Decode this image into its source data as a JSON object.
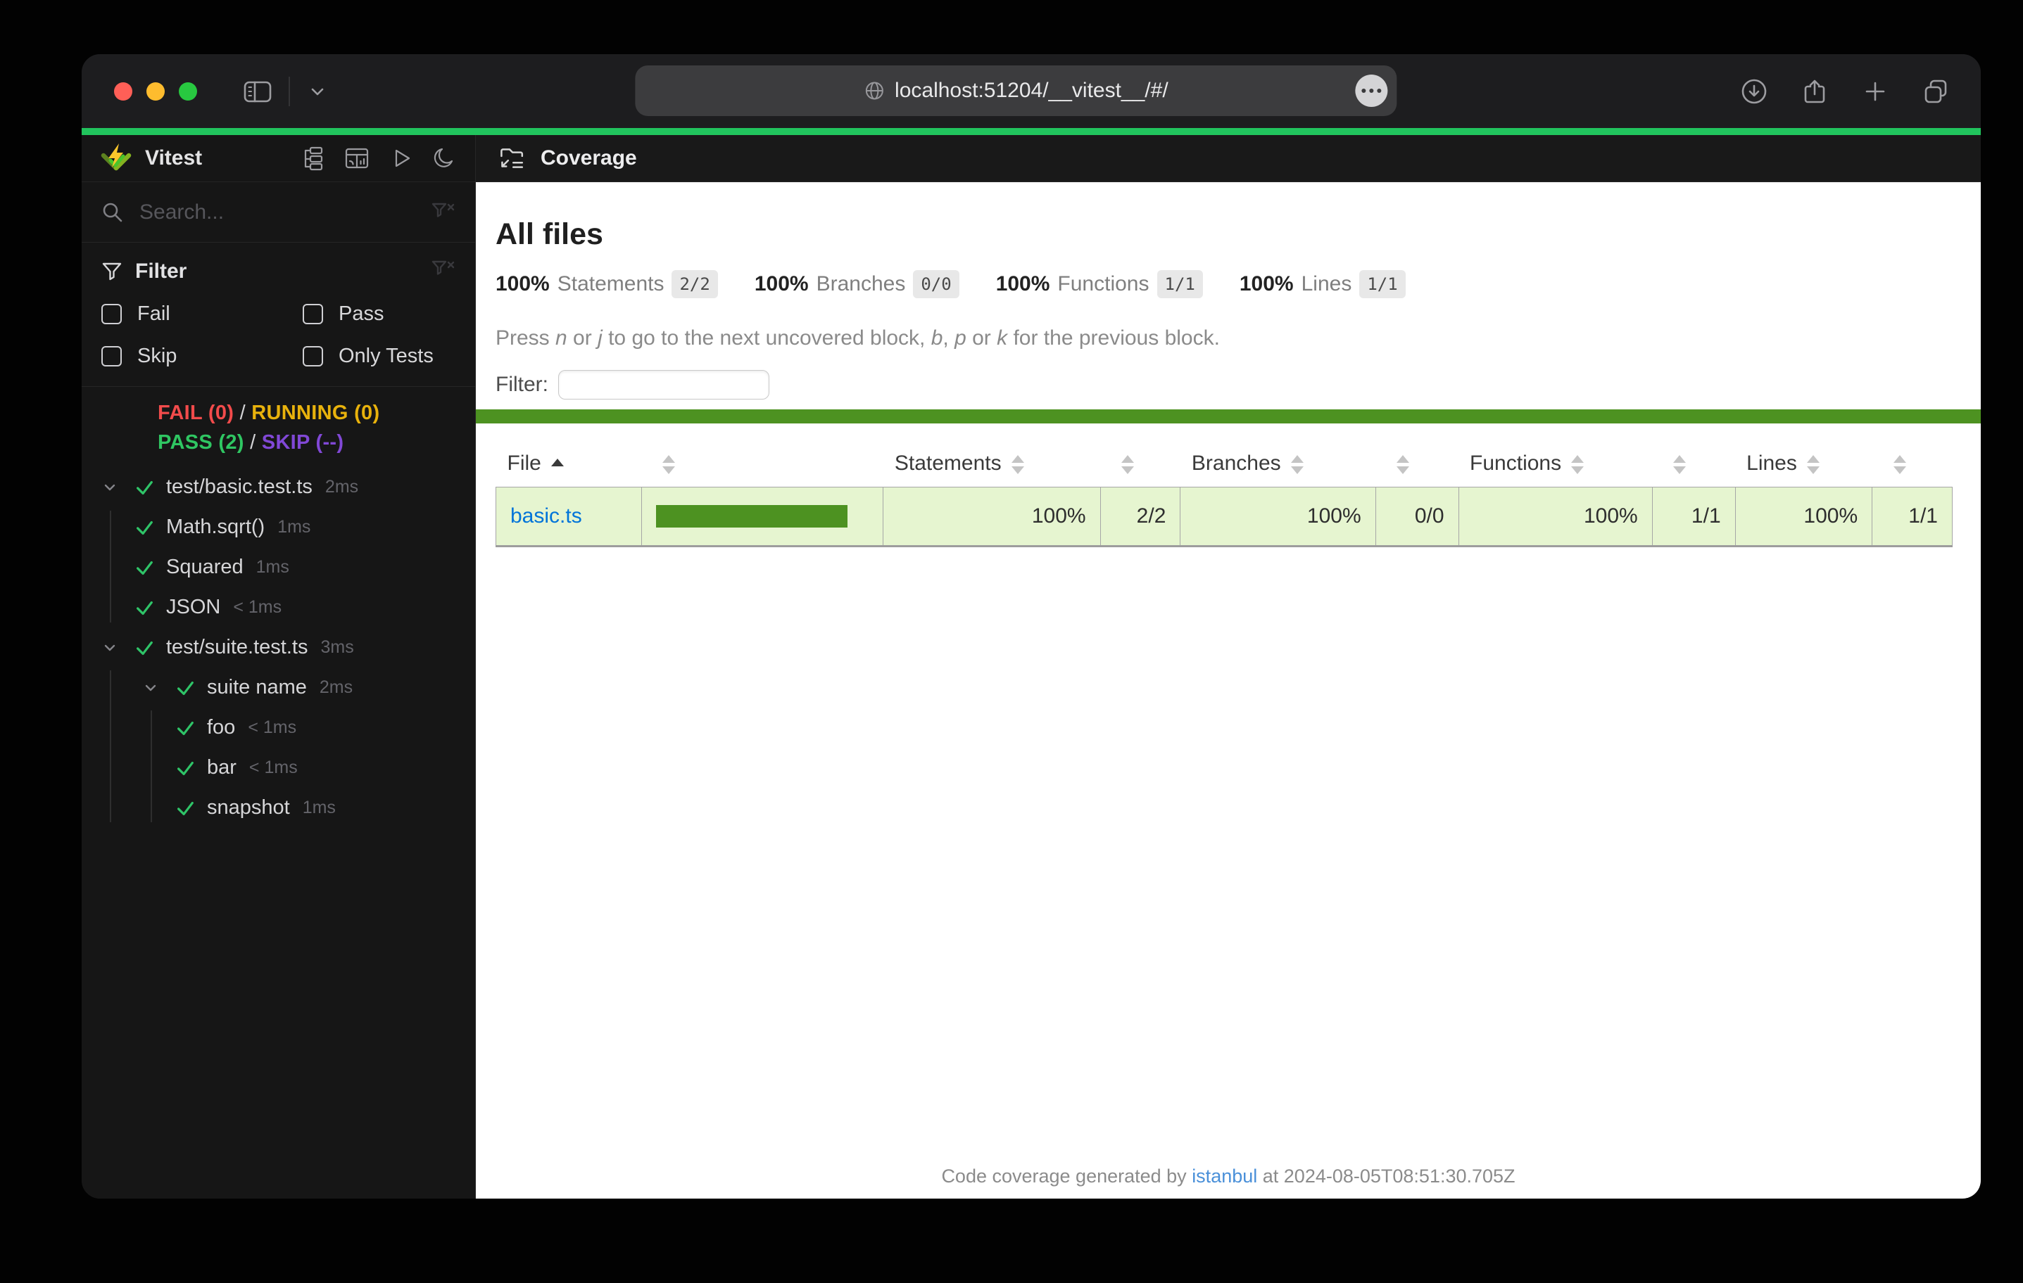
{
  "browser": {
    "url": "localhost:51204/__vitest__/#/"
  },
  "icons": {
    "traffic-lights": "red/yellow/green circles",
    "sidebar-toggle": "split rectangle",
    "chevron-down": "v",
    "globe": "circle with meridians",
    "page-menu": "three dots in circle",
    "download": "circle with down arrow",
    "share": "square with up arrow",
    "new-tab": "plus",
    "tab-overview": "two overlapping squares",
    "vitest-logo": "green V with yellow lightning bolt",
    "tree-view": "three linked blocks",
    "dashboard": "window with chart",
    "run-all": "play triangle outline",
    "dark-mode": "crescent moon",
    "search": "magnifier",
    "filter": "funnel",
    "clear-filter": "funnel with x",
    "pass-check": "green checkmark",
    "coverage": "folder with arrow and lines",
    "sorter": "up and down triangles"
  },
  "sidebar": {
    "app_title": "Vitest",
    "search_placeholder": "Search...",
    "filter": {
      "title": "Filter",
      "options": [
        "Fail",
        "Pass",
        "Skip",
        "Only Tests"
      ]
    },
    "status": {
      "fail": "FAIL (0)",
      "sep": " / ",
      "running": "RUNNING (0)",
      "pass": "PASS (2)",
      "skip": "SKIP (--)"
    },
    "tree": [
      {
        "label": "test/basic.test.ts",
        "duration": "2ms"
      },
      {
        "label": "Math.sqrt()",
        "duration": "1ms"
      },
      {
        "label": "Squared",
        "duration": "1ms"
      },
      {
        "label": "JSON",
        "duration": "< 1ms"
      },
      {
        "label": "test/suite.test.ts",
        "duration": "3ms"
      },
      {
        "label": "suite name",
        "duration": "2ms"
      },
      {
        "label": "foo",
        "duration": "< 1ms"
      },
      {
        "label": "bar",
        "duration": "< 1ms"
      },
      {
        "label": "snapshot",
        "duration": "1ms"
      }
    ]
  },
  "main": {
    "header_title": "Coverage",
    "report": {
      "title": "All files",
      "stats": [
        {
          "pct": "100%",
          "label": "Statements",
          "frac": "2/2"
        },
        {
          "pct": "100%",
          "label": "Branches",
          "frac": "0/0"
        },
        {
          "pct": "100%",
          "label": "Functions",
          "frac": "1/1"
        },
        {
          "pct": "100%",
          "label": "Lines",
          "frac": "1/1"
        }
      ],
      "hint": {
        "p1": "Press ",
        "k1": "n",
        "p2": " or ",
        "k2": "j",
        "p3": " to go to the next uncovered block, ",
        "k3": "b",
        "p4": ", ",
        "k4": "p",
        "p5": " or ",
        "k5": "k",
        "p6": " for the previous block."
      },
      "filter_label": "Filter:",
      "table": {
        "headers": {
          "file": "File",
          "statements": "Statements",
          "branches": "Branches",
          "functions": "Functions",
          "lines": "Lines"
        },
        "row": {
          "file": "basic.ts",
          "statements_pct": "100%",
          "statements_raw": "2/2",
          "branches_pct": "100%",
          "branches_raw": "0/0",
          "functions_pct": "100%",
          "functions_raw": "1/1",
          "lines_pct": "100%",
          "lines_raw": "1/1"
        }
      },
      "footer": {
        "pre": "Code coverage generated by ",
        "link": "istanbul",
        "post": " at 2024-08-05T08:51:30.705Z"
      }
    }
  },
  "colors": {
    "accent_green": "#21c45d",
    "coverage_green": "#4d9221",
    "coverage_row_bg": "#e6f5d0",
    "fail_red": "#f24b4b",
    "running_yellow": "#e8b20c",
    "pass_green": "#2fc662",
    "skip_purple": "#8148d6",
    "link_blue": "#0074d9"
  }
}
